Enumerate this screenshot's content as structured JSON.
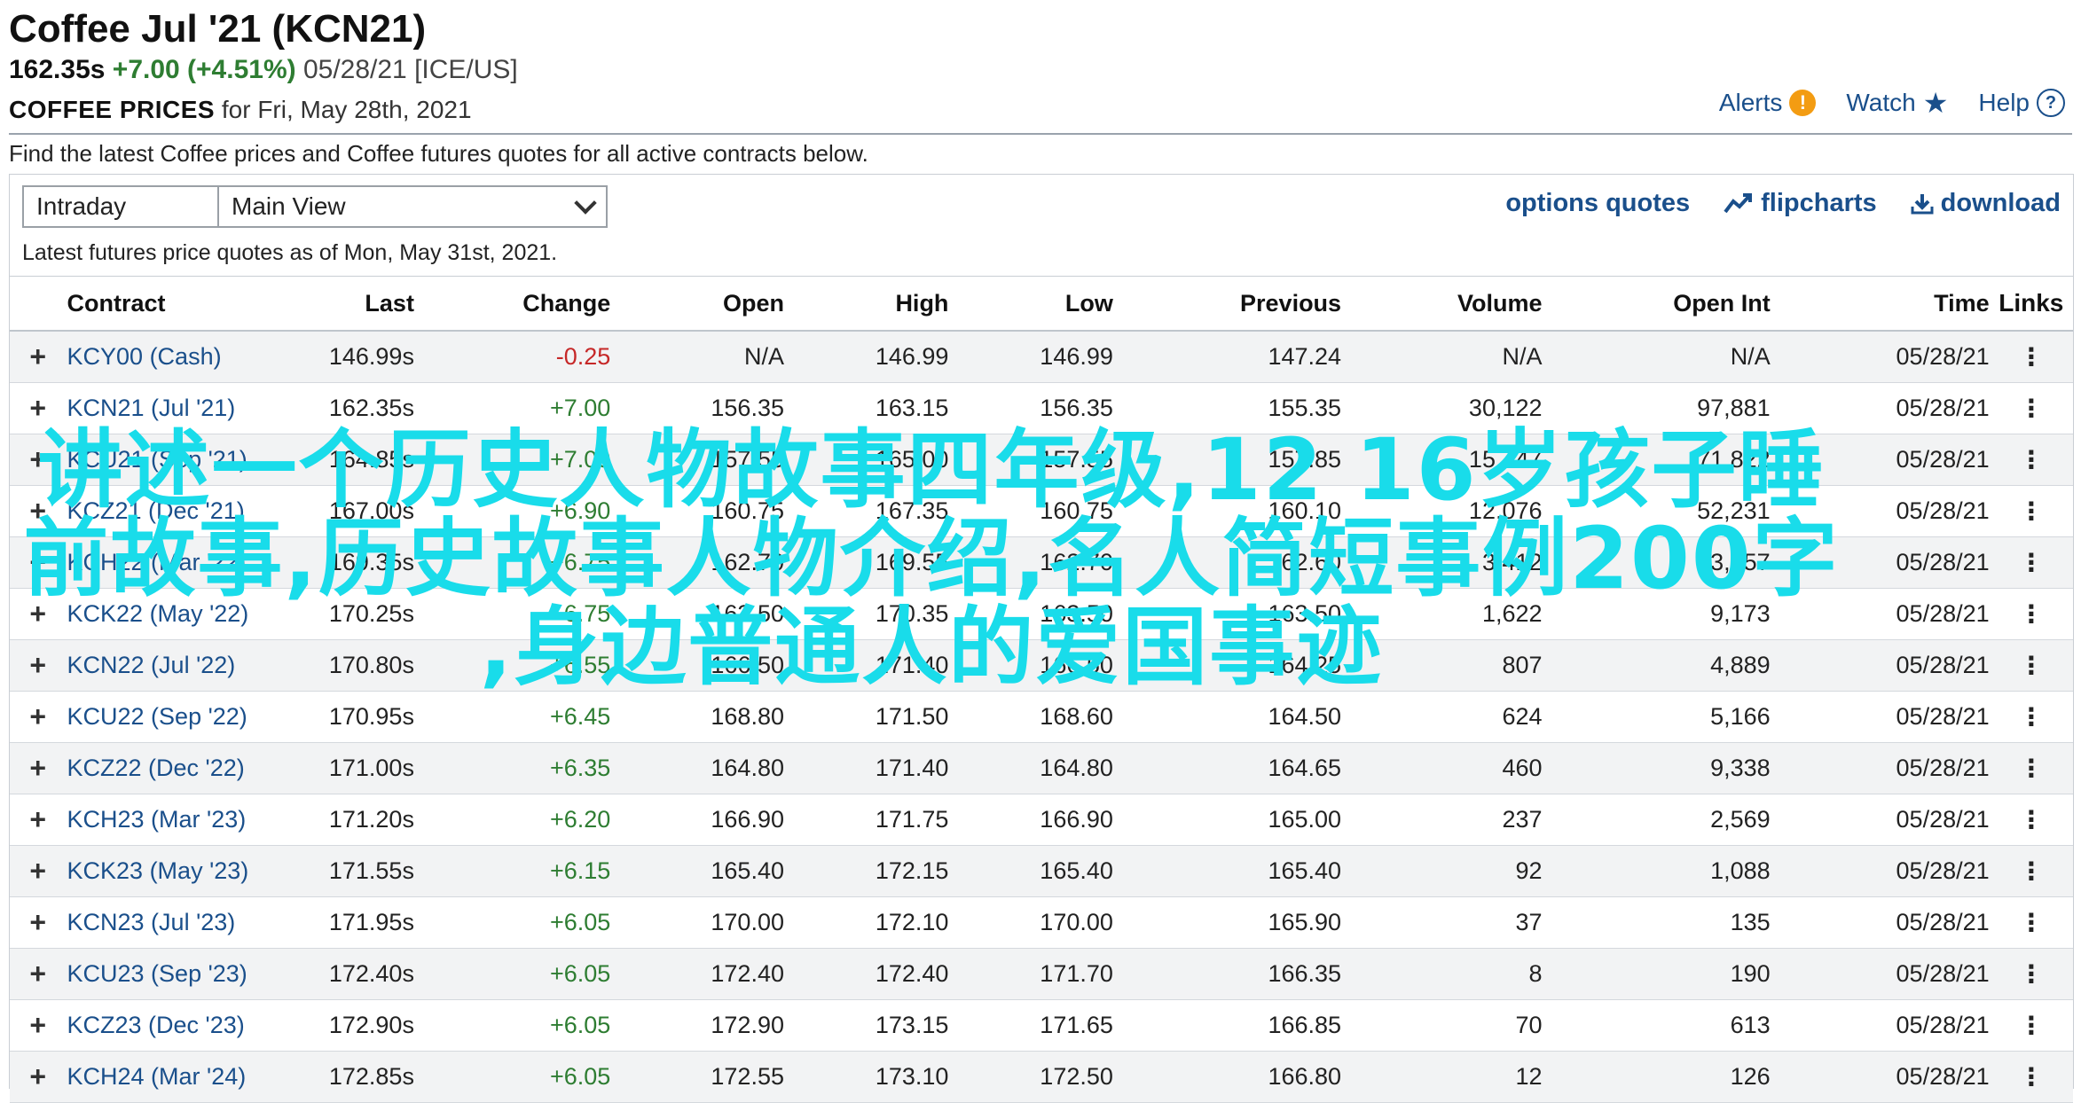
{
  "header": {
    "title": "Coffee Jul '21 (KCN21)",
    "last": "162.35s",
    "change": "+7.00 (+4.51%)",
    "date_exchange": "05/28/21 [ICE/US]",
    "prices_label": "COFFEE PRICES",
    "prices_for": "for Fri, May 28th, 2021"
  },
  "topnav": {
    "alerts": "Alerts",
    "watch": "Watch",
    "help": "Help"
  },
  "intro": "Find the latest Coffee prices and Coffee futures quotes for all active contracts below.",
  "toolbar": {
    "period_select": "Intraday",
    "view_select": "Main View",
    "options_quotes": "options quotes",
    "flipcharts": "flipcharts",
    "download": "download",
    "asof": "Latest futures price quotes as of Mon, May 31st, 2021."
  },
  "table": {
    "columns": [
      "Contract",
      "Last",
      "Change",
      "Open",
      "High",
      "Low",
      "Previous",
      "Volume",
      "Open Int",
      "Time",
      "Links"
    ],
    "rows": [
      [
        "KCY00 (Cash)",
        "146.99s",
        "-0.25",
        "N/A",
        "146.99",
        "146.99",
        "147.24",
        "N/A",
        "N/A",
        "05/28/21"
      ],
      [
        "KCN21 (Jul '21)",
        "162.35s",
        "+7.00",
        "156.35",
        "163.15",
        "156.35",
        "155.35",
        "30,122",
        "97,881",
        "05/28/21"
      ],
      [
        "KCU21 (Sep '21)",
        "164.85s",
        "+7.00",
        "157.55",
        "165.00",
        "157.55",
        "157.85",
        "15,447",
        "71,822",
        "05/28/21"
      ],
      [
        "KCZ21 (Dec '21)",
        "167.00s",
        "+6.90",
        "160.75",
        "167.35",
        "160.75",
        "160.10",
        "12,076",
        "52,231",
        "05/28/21"
      ],
      [
        "KCH22 (Mar '22)",
        "169.35s",
        "+6.75",
        "162.70",
        "169.55",
        "162.70",
        "162.60",
        "3,412",
        "23,457",
        "05/28/21"
      ],
      [
        "KCK22 (May '22)",
        "170.25s",
        "+6.75",
        "163.50",
        "170.35",
        "163.50",
        "163.50",
        "1,622",
        "9,173",
        "05/28/21"
      ],
      [
        "KCN22 (Jul '22)",
        "170.80s",
        "+6.55",
        "166.50",
        "171.40",
        "166.50",
        "164.25",
        "807",
        "4,889",
        "05/28/21"
      ],
      [
        "KCU22 (Sep '22)",
        "170.95s",
        "+6.45",
        "168.80",
        "171.50",
        "168.60",
        "164.50",
        "624",
        "5,166",
        "05/28/21"
      ],
      [
        "KCZ22 (Dec '22)",
        "171.00s",
        "+6.35",
        "164.80",
        "171.40",
        "164.80",
        "164.65",
        "460",
        "9,338",
        "05/28/21"
      ],
      [
        "KCH23 (Mar '23)",
        "171.20s",
        "+6.20",
        "166.90",
        "171.75",
        "166.90",
        "165.00",
        "237",
        "2,569",
        "05/28/21"
      ],
      [
        "KCK23 (May '23)",
        "171.55s",
        "+6.15",
        "165.40",
        "172.15",
        "165.40",
        "165.40",
        "92",
        "1,088",
        "05/28/21"
      ],
      [
        "KCN23 (Jul '23)",
        "171.95s",
        "+6.05",
        "170.00",
        "172.10",
        "170.00",
        "165.90",
        "37",
        "135",
        "05/28/21"
      ],
      [
        "KCU23 (Sep '23)",
        "172.40s",
        "+6.05",
        "172.40",
        "172.40",
        "171.70",
        "166.35",
        "8",
        "190",
        "05/28/21"
      ],
      [
        "KCZ23 (Dec '23)",
        "172.90s",
        "+6.05",
        "172.90",
        "173.15",
        "171.65",
        "166.85",
        "70",
        "613",
        "05/28/21"
      ],
      [
        "KCH24 (Mar '24)",
        "172.85s",
        "+6.05",
        "172.55",
        "173.10",
        "172.50",
        "166.80",
        "12",
        "126",
        "05/28/21"
      ]
    ]
  },
  "overlay": {
    "line1": "讲述一个历史人物故事四年级,12 16岁孩子睡",
    "line2": "前故事,历史故事人物介绍,名人简短事例200字",
    "line3": ",身边普通人的爱国事迹"
  },
  "colors": {
    "link": "#1a4f8b",
    "positive": "#2e7d32",
    "negative": "#c62828",
    "overlay": "#19dcea",
    "alert": "#f39c12"
  }
}
